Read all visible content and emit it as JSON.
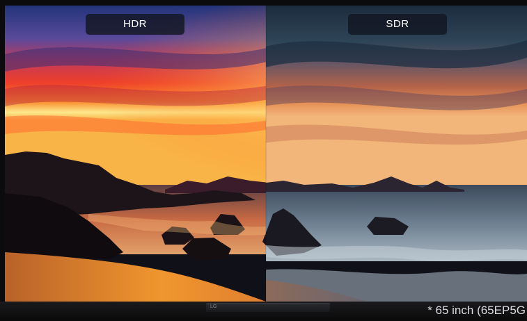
{
  "labels": {
    "left": "HDR",
    "right": "SDR"
  },
  "tv": {
    "logo": "LG",
    "caption": "* 65 inch (65EP5G"
  },
  "scene": {
    "description_icon": "sunset-seascape-photo",
    "colors": {
      "hdr_sky_top": "#2b3f86",
      "hdr_sky_glow": "#f6e08a",
      "hdr_sky_red": "#e2342a",
      "sdr_sky_top": "#1e3145",
      "sdr_sky_glow": "#f0a96a",
      "sand": "#d78a3a",
      "rock": "#151014"
    }
  }
}
